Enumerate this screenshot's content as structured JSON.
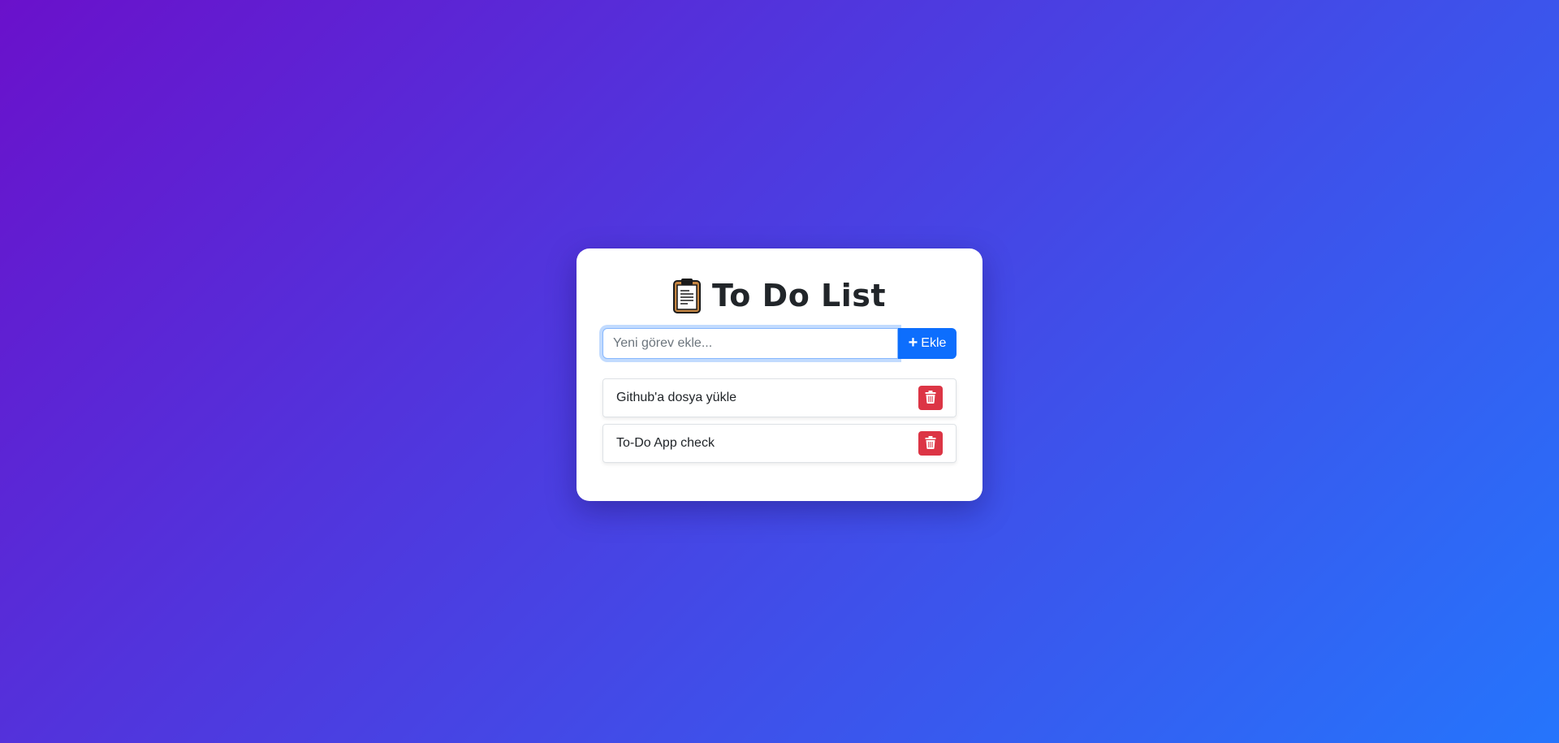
{
  "app": {
    "title_icon": "clipboard-icon",
    "title": "To Do List"
  },
  "form": {
    "placeholder": "Yeni görev ekle...",
    "value": "",
    "add_icon": "plus-icon",
    "add_label": "Ekle"
  },
  "tasks": [
    {
      "text": "Github'a dosya yükle",
      "delete_icon": "trash-icon"
    },
    {
      "text": "To-Do App check",
      "delete_icon": "trash-icon"
    }
  ],
  "colors": {
    "background_start": "#6a11cb",
    "background_end": "#2575fc",
    "primary": "#0d6efd",
    "danger": "#dc3545",
    "card": "#ffffff"
  }
}
